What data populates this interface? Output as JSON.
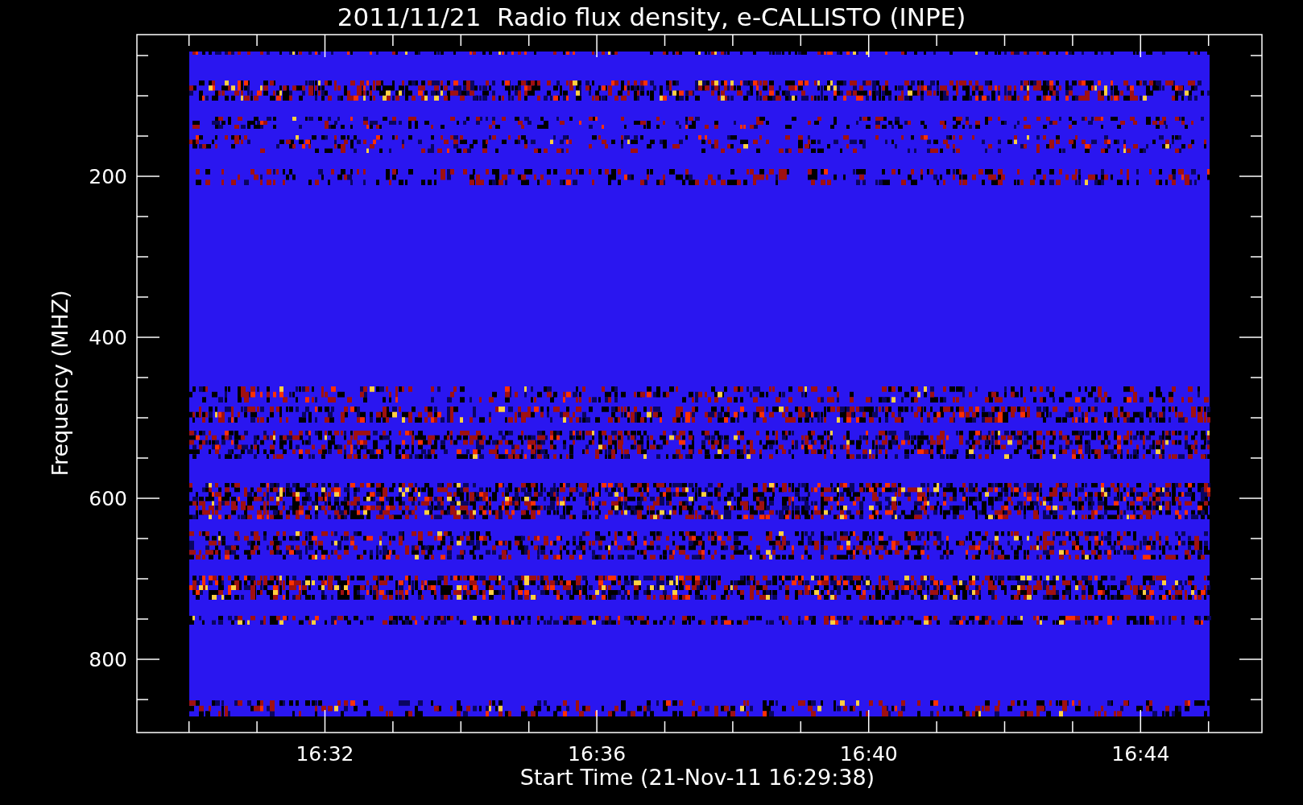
{
  "title": "2011/11/21  Radio flux density, e-CALLISTO (INPE)",
  "y_axis": {
    "label": "Frequency (MHZ)",
    "ticks": [
      "200",
      "400",
      "600",
      "800"
    ]
  },
  "x_axis": {
    "label": "Start Time (21-Nov-11 16:29:38)",
    "ticks": [
      "16:32",
      "16:36",
      "16:40",
      "16:44"
    ]
  }
}
